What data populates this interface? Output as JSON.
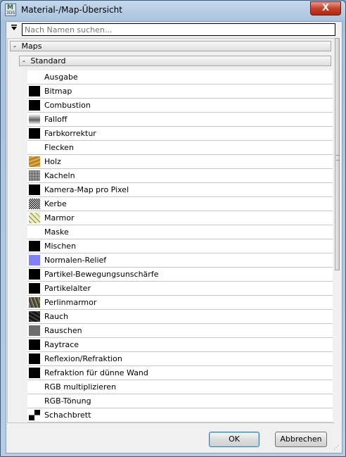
{
  "window": {
    "title": "Material-/Map-Übersicht",
    "close_symbol": "X",
    "app_icon_text": "M",
    "app_icon_subtext": "3DS"
  },
  "search": {
    "placeholder": "Nach Namen suchen...",
    "filter_icon": "triangle-down-icon"
  },
  "groups": {
    "maps_label": "Maps",
    "standard_label": "Standard",
    "collapse_symbol": "-"
  },
  "items": [
    {
      "label": "Ausgabe",
      "swatch": "white"
    },
    {
      "label": "Bitmap",
      "swatch": "black"
    },
    {
      "label": "Combustion",
      "swatch": "black"
    },
    {
      "label": "Falloff",
      "swatch": "falloff"
    },
    {
      "label": "Farbkorrektur",
      "swatch": "black"
    },
    {
      "label": "Flecken",
      "swatch": "white"
    },
    {
      "label": "Holz",
      "swatch": "wood"
    },
    {
      "label": "Kacheln",
      "swatch": "tiles"
    },
    {
      "label": "Kamera-Map pro Pixel",
      "swatch": "black"
    },
    {
      "label": "Kerbe",
      "swatch": "dent"
    },
    {
      "label": "Marmor",
      "swatch": "marble"
    },
    {
      "label": "Maske",
      "swatch": "white"
    },
    {
      "label": "Mischen",
      "swatch": "black"
    },
    {
      "label": "Normalen-Relief",
      "swatch": "normal"
    },
    {
      "label": "Partikel-Bewegungsunschärfe",
      "swatch": "black"
    },
    {
      "label": "Partikelalter",
      "swatch": "black"
    },
    {
      "label": "Perlinmarmor",
      "swatch": "perlin"
    },
    {
      "label": "Rauch",
      "swatch": "smoke"
    },
    {
      "label": "Rauschen",
      "swatch": "noise"
    },
    {
      "label": "Raytrace",
      "swatch": "black"
    },
    {
      "label": "Reflexion/Refraktion",
      "swatch": "black"
    },
    {
      "label": "Refraktion für dünne Wand",
      "swatch": "black"
    },
    {
      "label": "RGB multiplizieren",
      "swatch": "white"
    },
    {
      "label": "RGB-Tönung",
      "swatch": "white"
    },
    {
      "label": "Schachbrett",
      "swatch": "checker"
    }
  ],
  "buttons": {
    "ok_label": "OK",
    "cancel_label": "Abbrechen"
  },
  "colors": {
    "title_bar": "#b6cce2",
    "close_button": "#c8402a",
    "list_background": "#ffffff",
    "normal_bump_swatch": "#8080ff"
  }
}
